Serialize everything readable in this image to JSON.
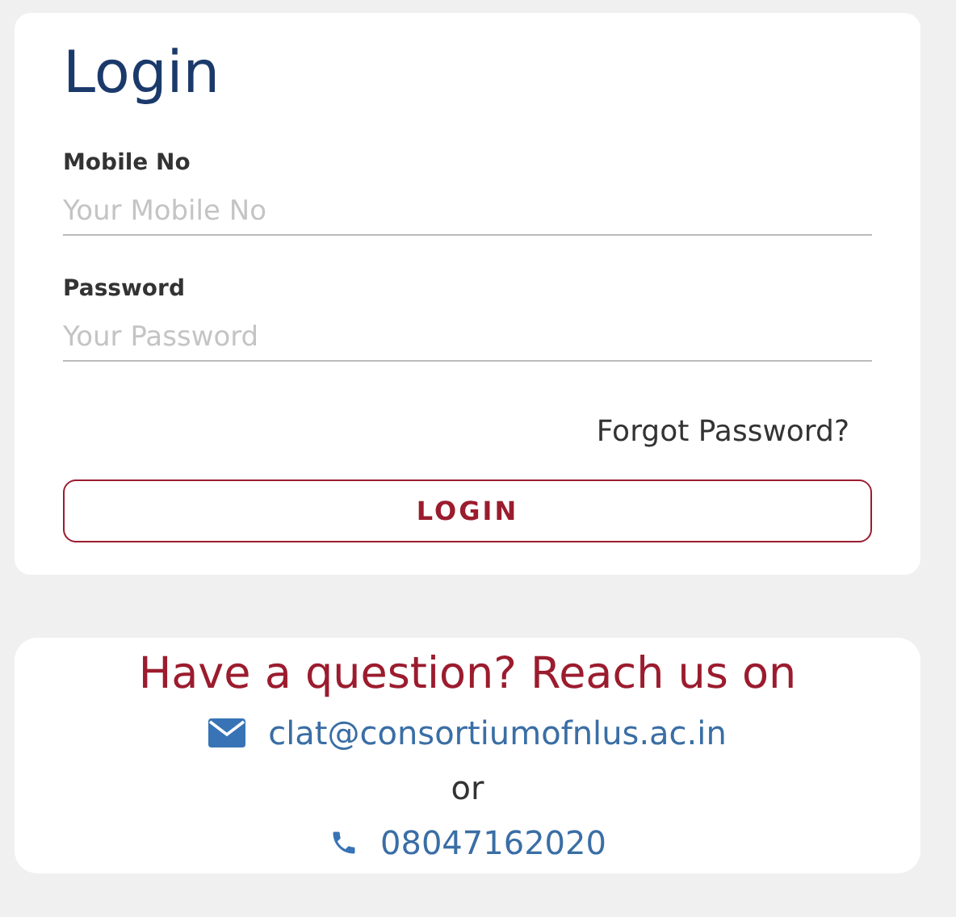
{
  "login": {
    "title": "Login",
    "fields": [
      {
        "label": "Mobile No",
        "placeholder": "Your Mobile No"
      },
      {
        "label": "Password",
        "placeholder": "Your Password"
      }
    ],
    "forgot_link": "Forgot Password?",
    "button": "LOGIN"
  },
  "contact": {
    "heading": "Have a question? Reach us on",
    "items": [
      {
        "kind": "email",
        "text": "clat@consortiumofnlus.ac.in"
      },
      {
        "kind": "separator",
        "text": "or"
      },
      {
        "kind": "phone",
        "text": "08047162020"
      }
    ]
  }
}
